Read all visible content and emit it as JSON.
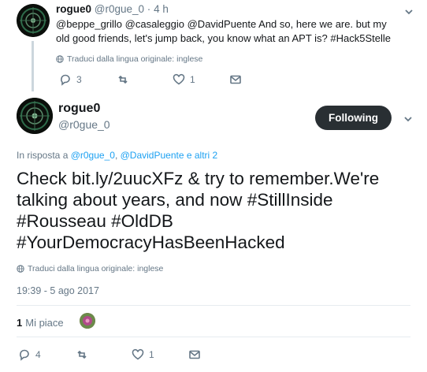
{
  "parent_tweet": {
    "name": "rogue0",
    "handle": "@r0gue_0",
    "separator": "·",
    "time": "4 h",
    "text_mentions": "@beppe_grillo @casaleggio @DavidPuente",
    "text_body": " And so, here we are. but my old good friends, let's jump back, you know what an APT is? ",
    "text_hashtag": "#Hack5Stelle",
    "translate_label": "Traduci dalla lingua originale: inglese",
    "replies": "3",
    "retweets": "",
    "likes": "1"
  },
  "main_tweet": {
    "name": "rogue0",
    "handle": "@r0gue_0",
    "follow_label": "Following",
    "reply_prefix": "In risposta a ",
    "reply_user1": "@r0gue_0",
    "reply_comma": ", ",
    "reply_user2": "@DavidPuente",
    "reply_suffix": " e altri 2",
    "text_part1": "Check ",
    "text_link": "bit.ly/2uucXFz",
    "text_part2": " & try to remember.We're talking about years, and now ",
    "hashtag1": "#StillInside",
    "space1": " ",
    "hashtag2": "#Rousseau",
    "space2": " ",
    "hashtag3": "#OldDB",
    "space3": " ",
    "hashtag4": "#YourDemocracyHasBeenHacked",
    "translate_label": "Traduci dalla lingua originale: inglese",
    "timestamp": "19:39 - 5 ago 2017",
    "likes_count": "1",
    "likes_label": "Mi piace",
    "replies": "4",
    "retweets": "",
    "like_action_count": "1"
  },
  "colors": {
    "link": "#1da1f2",
    "muted": "#657786",
    "follow_button_bg": "#292f33"
  },
  "icons": [
    "chevron-down-icon",
    "globe-icon",
    "reply-icon",
    "retweet-icon",
    "heart-icon",
    "message-icon"
  ]
}
